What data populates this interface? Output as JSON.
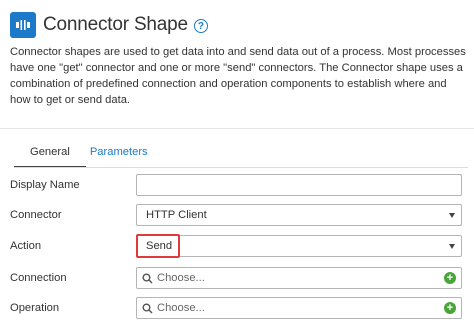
{
  "header": {
    "title": "Connector Shape",
    "shape_icon": "connector-shape-icon",
    "help_icon": "help-circle-icon",
    "help_glyph": "?"
  },
  "description": "Connector shapes are used to get data into and send data out of a process. Most processes have one \"get\" connector and one or more \"send\" connectors. The Connector shape uses a combination of predefined connection and operation components to establish where and how to get or send data.",
  "tabs": [
    {
      "label": "General",
      "active": true
    },
    {
      "label": "Parameters",
      "active": false
    }
  ],
  "form": {
    "display_name": {
      "label": "Display Name",
      "value": ""
    },
    "connector": {
      "label": "Connector",
      "value": "HTTP Client"
    },
    "action": {
      "label": "Action",
      "value": "Send"
    },
    "connection": {
      "label": "Connection",
      "placeholder": "Choose..."
    },
    "operation": {
      "label": "Operation",
      "placeholder": "Choose..."
    }
  },
  "colors": {
    "accent": "#1c7ac9",
    "highlight": "#e03b3b",
    "add": "#4aa33b"
  }
}
